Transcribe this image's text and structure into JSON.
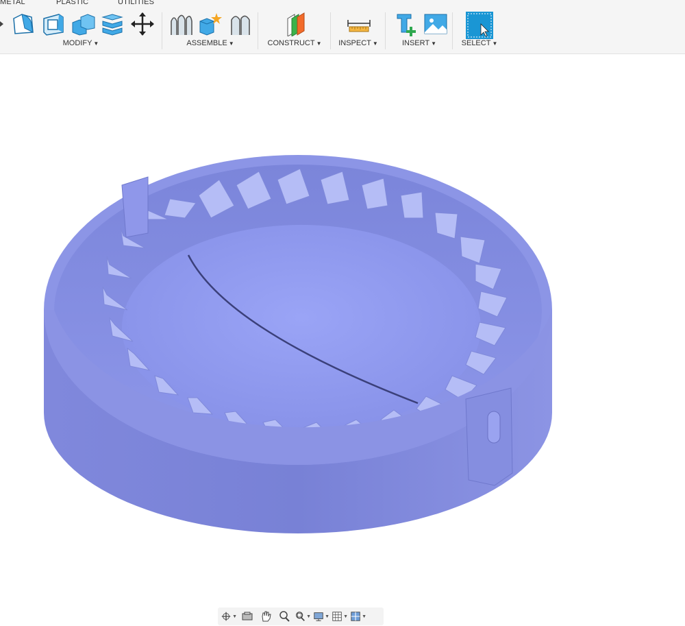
{
  "tabs": [
    "METAL",
    "PLASTIC",
    "UTILITIES"
  ],
  "groups": {
    "modify": {
      "label": "MODIFY"
    },
    "assemble": {
      "label": "ASSEMBLE"
    },
    "construct": {
      "label": "CONSTRUCT"
    },
    "inspect": {
      "label": "INSPECT"
    },
    "insert": {
      "label": "INSERT"
    },
    "select": {
      "label": "SELECT"
    }
  },
  "icons": {
    "modify": [
      "press-pull-icon",
      "fillet-icon",
      "shell-icon",
      "combine-icon",
      "offset-face-icon",
      "move-icon"
    ],
    "assemble": [
      "joint-icon",
      "new-component-icon",
      "as-built-joint-icon"
    ],
    "construct": [
      "offset-plane-icon"
    ],
    "inspect": [
      "measure-icon"
    ],
    "insert": [
      "insert-mcmaster-icon",
      "insert-canvas-icon"
    ],
    "select": [
      "select-icon"
    ]
  },
  "navbar": [
    "orbit-icon",
    "look-at-icon",
    "pan-icon",
    "zoom-icon",
    "fit-icon",
    "display-settings-icon",
    "grid-settings-icon",
    "viewports-icon"
  ],
  "colors": {
    "model": "#8a93e8",
    "accent": "#1a96d4",
    "toolbar_bg": "#f5f5f5"
  }
}
